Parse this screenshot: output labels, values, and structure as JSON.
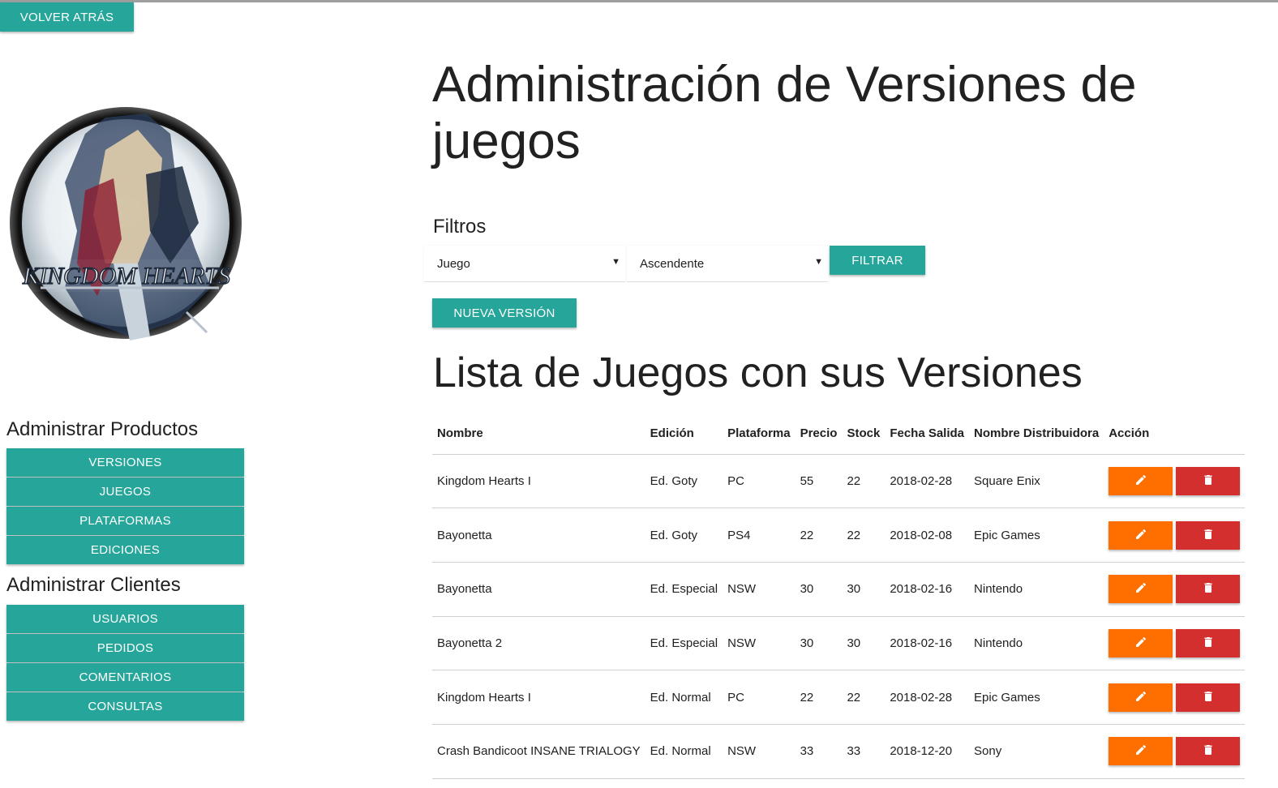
{
  "header": {
    "back_label": "VOLVER ATRÁS"
  },
  "sidebar": {
    "products_title": "Administrar Productos",
    "products_items": [
      "VERSIONES",
      "JUEGOS",
      "PLATAFORMAS",
      "EDICIONES"
    ],
    "clients_title": "Administrar Clientes",
    "clients_items": [
      "USUARIOS",
      "PEDIDOS",
      "COMENTARIOS",
      "CONSULTAS"
    ]
  },
  "logo": {
    "text": "KINGDOM HEARTS"
  },
  "main": {
    "title": "Administración de Versiones de juegos",
    "filters_label": "Filtros",
    "filter_field_value": "Juego",
    "filter_order_value": "Ascendente",
    "filter_button": "FILTRAR",
    "new_button": "NUEVA VERSIÓN",
    "list_title": "Lista de Juegos con sus Versiones"
  },
  "table": {
    "columns": [
      "Nombre",
      "Edición",
      "Plataforma",
      "Precio",
      "Stock",
      "Fecha Salida",
      "Nombre Distribuidora",
      "Acción"
    ],
    "rows": [
      [
        "Kingdom Hearts I",
        "Ed. Goty",
        "PC",
        "55",
        "22",
        "2018-02-28",
        "Square Enix"
      ],
      [
        "Bayonetta",
        "Ed. Goty",
        "PS4",
        "22",
        "22",
        "2018-02-08",
        "Epic Games"
      ],
      [
        "Bayonetta",
        "Ed. Especial",
        "NSW",
        "30",
        "30",
        "2018-02-16",
        "Nintendo"
      ],
      [
        "Bayonetta 2",
        "Ed. Especial",
        "NSW",
        "30",
        "30",
        "2018-02-16",
        "Nintendo"
      ],
      [
        "Kingdom Hearts I",
        "Ed. Normal",
        "PC",
        "22",
        "22",
        "2018-02-28",
        "Epic Games"
      ],
      [
        "Crash Bandicoot INSANE TRIALOGY",
        "Ed. Normal",
        "NSW",
        "33",
        "33",
        "2018-12-20",
        "Sony"
      ]
    ]
  },
  "colors": {
    "primary": "#26a69a",
    "edit": "#ff6f00",
    "delete": "#d32f2f"
  },
  "icons": {
    "edit": "pencil-icon",
    "delete": "trash-icon",
    "select": "dropdown-arrow-icon"
  }
}
